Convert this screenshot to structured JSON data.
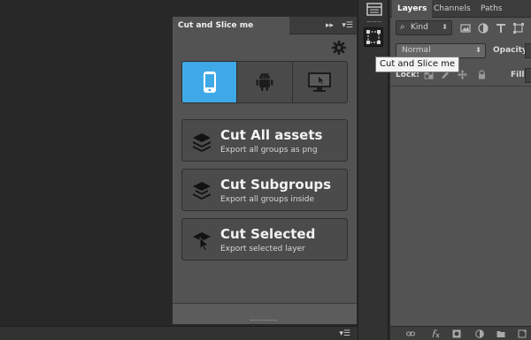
{
  "plugin_panel": {
    "tab_title": "Cut and Slice me",
    "collapse_label": "▸▸",
    "menu_label": "▾☰",
    "platforms": [
      {
        "name": "iOS",
        "icon": "smartphone-icon",
        "active": true
      },
      {
        "name": "Android",
        "icon": "android-icon",
        "active": false
      },
      {
        "name": "Desktop",
        "icon": "monitor-icon",
        "active": false
      }
    ],
    "buttons": [
      {
        "title": "Cut All assets",
        "subtitle": "Export all groups as png"
      },
      {
        "title": "Cut Subgroups",
        "subtitle": "Export all groups inside"
      },
      {
        "title": "Cut Selected",
        "subtitle": "Export selected layer"
      }
    ]
  },
  "tooltip": {
    "text": "Cut and Slice me"
  },
  "bottom_strip": {
    "menu_label": "▾☰"
  },
  "layers_panel": {
    "tabs": [
      "Layers",
      "Channels",
      "Paths"
    ],
    "active_tab": "Layers",
    "filter_label": "Kind",
    "blend_mode": "Normal",
    "opacity_label": "Opacity:",
    "lock_label": "Lock:",
    "fill_label": "Fill:"
  },
  "colors": {
    "accent": "#3fa9e8",
    "panel_bg": "#535353",
    "canvas_bg": "#282828"
  }
}
